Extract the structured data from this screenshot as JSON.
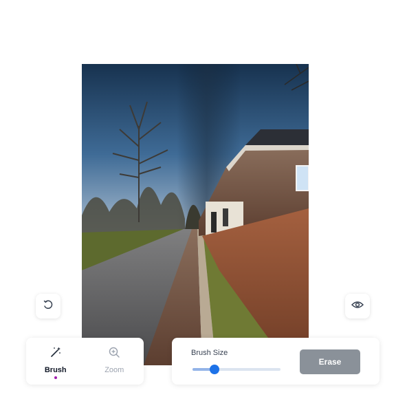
{
  "toolbar": {
    "tools": [
      {
        "label": "Brush",
        "icon": "magic-wand-icon",
        "active": true
      },
      {
        "label": "Zoom",
        "icon": "zoom-in-icon",
        "active": false
      }
    ]
  },
  "settings": {
    "brush_size_label": "Brush Size",
    "brush_size_fraction": 0.25,
    "erase_label": "Erase"
  },
  "floating": {
    "reset_icon": "reset-icon",
    "preview_icon": "eye-icon"
  },
  "colors": {
    "accent": "#1d72e8",
    "active_dot": "#a21caf",
    "erase_button": "#8a9199"
  }
}
